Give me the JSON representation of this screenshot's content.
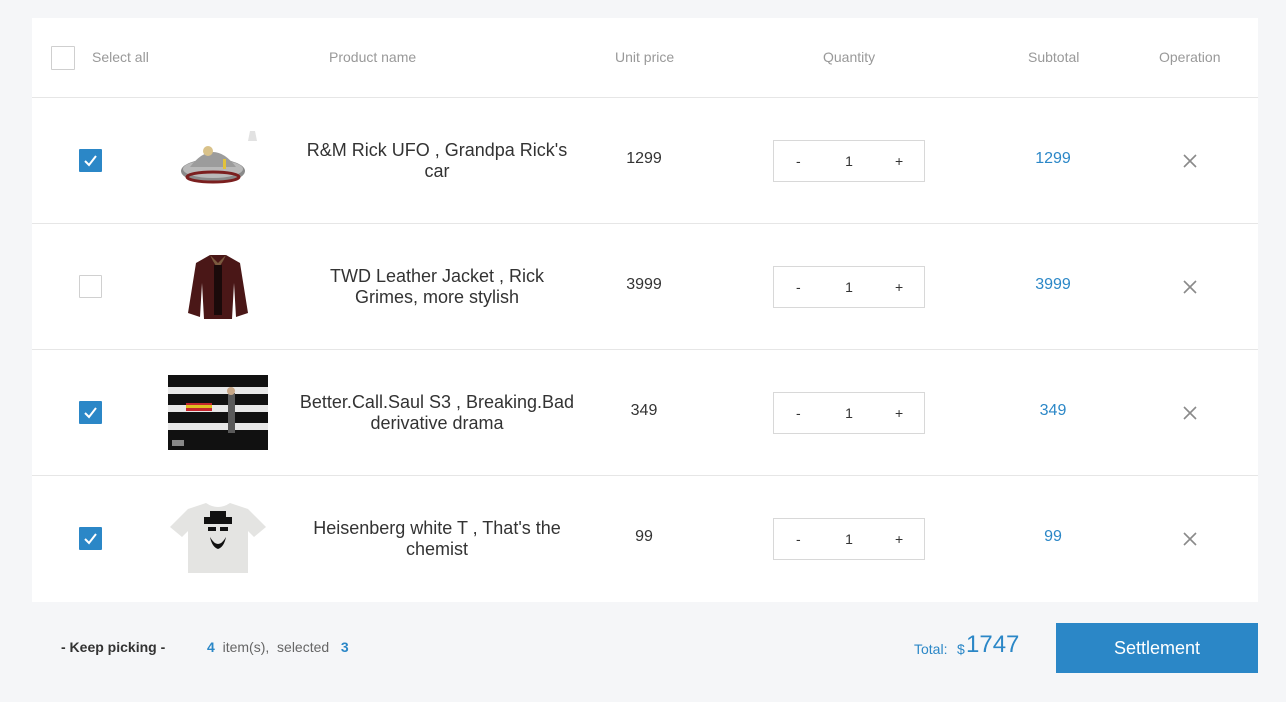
{
  "header": {
    "select_all": "Select all",
    "product_name": "Product name",
    "unit_price": "Unit price",
    "quantity": "Quantity",
    "subtotal": "Subtotal",
    "operation": "Operation"
  },
  "items": [
    {
      "name": "R&M Rick UFO , Grandpa Rick's car",
      "price": "1299",
      "quantity": "1",
      "subtotal": "1299",
      "checked": true,
      "image": "ufo-toy"
    },
    {
      "name": "TWD Leather Jacket , Rick Grimes, more stylish",
      "price": "3999",
      "quantity": "1",
      "subtotal": "3999",
      "checked": false,
      "image": "leather-jacket"
    },
    {
      "name": "Better.Call.Saul S3 , Breaking.Bad derivative drama",
      "price": "349",
      "quantity": "1",
      "subtotal": "349",
      "checked": true,
      "image": "tv-poster"
    },
    {
      "name": "Heisenberg white T , That's the chemist",
      "price": "99",
      "quantity": "1",
      "subtotal": "99",
      "checked": true,
      "image": "heisenberg-tshirt"
    }
  ],
  "qty_controls": {
    "minus": "-",
    "plus": "+"
  },
  "footer": {
    "keep_picking": "- Keep picking -",
    "item_count": "4",
    "items_label": "item(s),",
    "selected_label": "selected",
    "selected_count": "3",
    "total_label": "Total:",
    "currency": "$",
    "total_value": "1747",
    "settlement": "Settlement"
  },
  "colors": {
    "accent": "#2b87c7",
    "background": "#f5f6f8"
  }
}
